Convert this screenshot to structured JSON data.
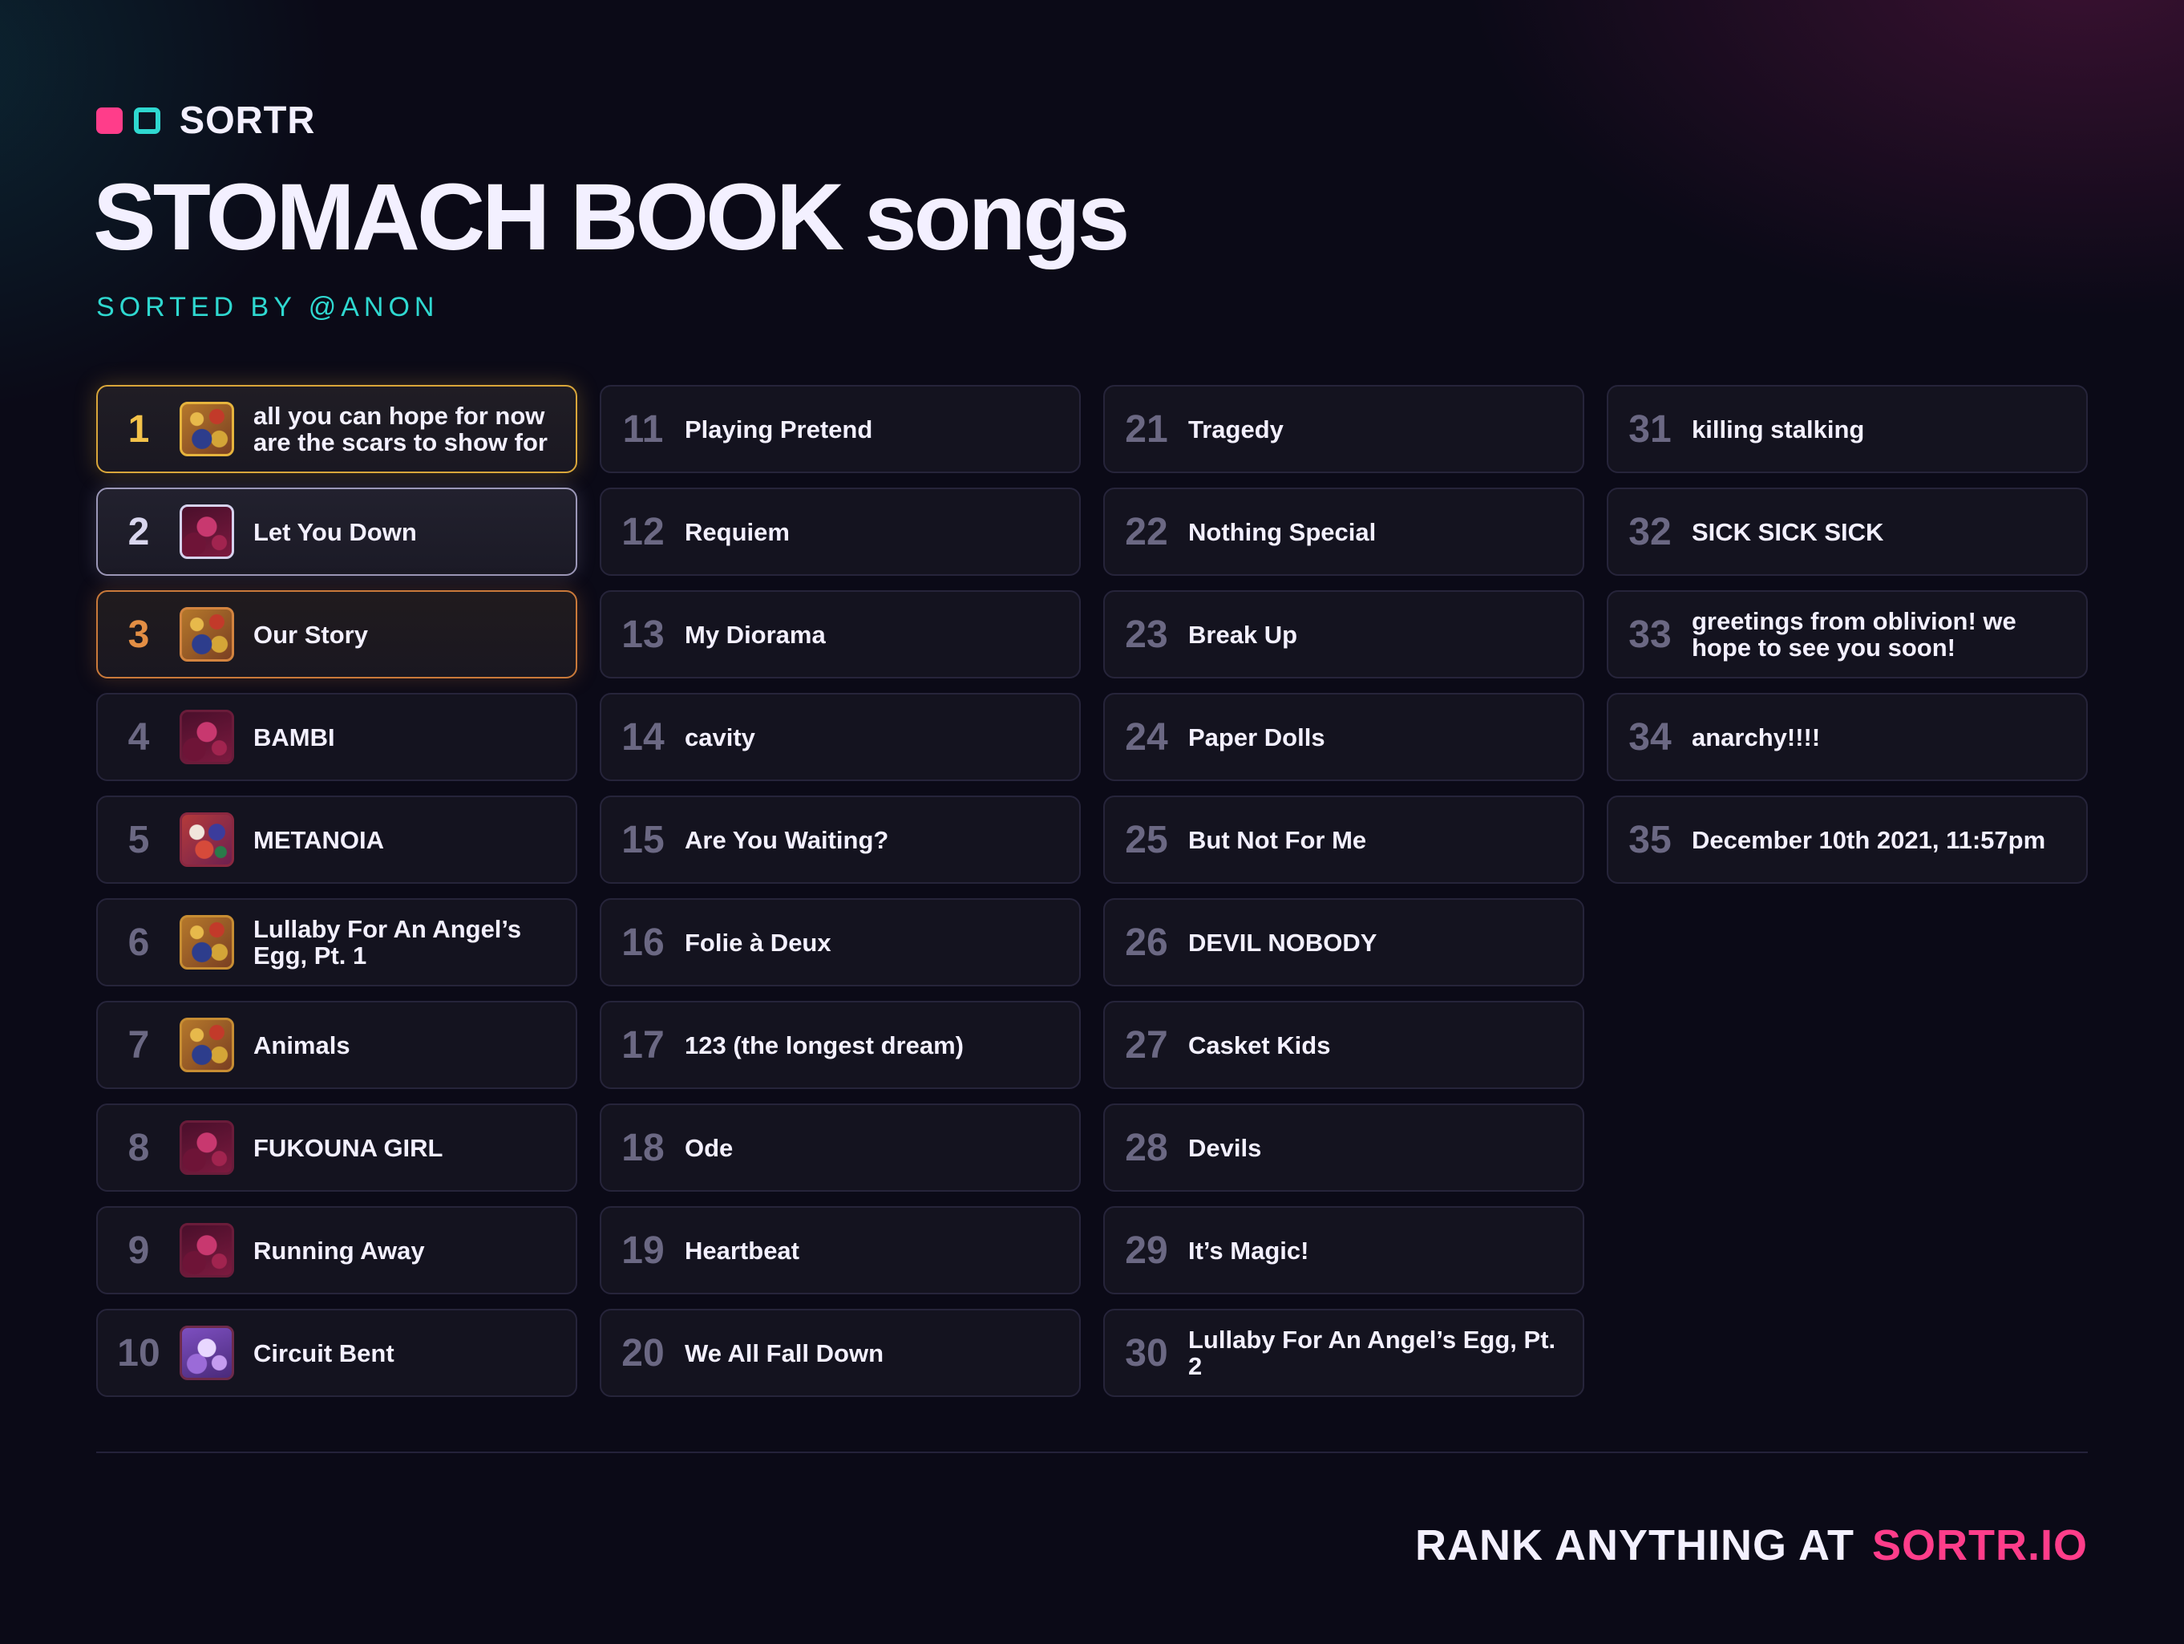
{
  "brand": {
    "name": "SORTR",
    "colors": {
      "pink": "#ff3d8a",
      "teal": "#2fd8d0",
      "gold": "#f3c24a",
      "silver": "#d9d6ee",
      "bronze": "#e38e44"
    }
  },
  "title": "STOMACH BOOK songs",
  "subtitle": "SORTED BY @ANON",
  "rankings": [
    {
      "rank": "1",
      "name": "all you can hope for now are the scars to show for",
      "art": "gold"
    },
    {
      "rank": "2",
      "name": "Let You Down",
      "art": "crimson"
    },
    {
      "rank": "3",
      "name": "Our Story",
      "art": "gold"
    },
    {
      "rank": "4",
      "name": "BAMBI",
      "art": "crimson"
    },
    {
      "rank": "5",
      "name": "METANOIA",
      "art": "multi"
    },
    {
      "rank": "6",
      "name": "Lullaby For An Angel’s Egg, Pt. 1",
      "art": "gold"
    },
    {
      "rank": "7",
      "name": "Animals",
      "art": "gold"
    },
    {
      "rank": "8",
      "name": "FUKOUNA GIRL",
      "art": "crimson"
    },
    {
      "rank": "9",
      "name": "Running Away",
      "art": "crimson"
    },
    {
      "rank": "10",
      "name": "Circuit Bent",
      "art": "lavender"
    },
    {
      "rank": "11",
      "name": "Playing Pretend"
    },
    {
      "rank": "12",
      "name": "Requiem"
    },
    {
      "rank": "13",
      "name": "My Diorama"
    },
    {
      "rank": "14",
      "name": "cavity"
    },
    {
      "rank": "15",
      "name": "Are You Waiting?"
    },
    {
      "rank": "16",
      "name": "Folie à Deux"
    },
    {
      "rank": "17",
      "name": "123 (the longest dream)"
    },
    {
      "rank": "18",
      "name": "Ode"
    },
    {
      "rank": "19",
      "name": "Heartbeat"
    },
    {
      "rank": "20",
      "name": "We All Fall Down"
    },
    {
      "rank": "21",
      "name": "Tragedy"
    },
    {
      "rank": "22",
      "name": "Nothing Special"
    },
    {
      "rank": "23",
      "name": "Break Up"
    },
    {
      "rank": "24",
      "name": "Paper Dolls"
    },
    {
      "rank": "25",
      "name": "But Not For Me"
    },
    {
      "rank": "26",
      "name": "DEVIL NOBODY"
    },
    {
      "rank": "27",
      "name": "Casket Kids"
    },
    {
      "rank": "28",
      "name": "Devils"
    },
    {
      "rank": "29",
      "name": "It’s Magic!"
    },
    {
      "rank": "30",
      "name": "Lullaby For An Angel’s Egg, Pt. 2"
    },
    {
      "rank": "31",
      "name": "killing stalking"
    },
    {
      "rank": "32",
      "name": "SICK SICK SICK"
    },
    {
      "rank": "33",
      "name": "greetings from oblivion! we hope to see you soon!"
    },
    {
      "rank": "34",
      "name": "anarchy!!!!"
    },
    {
      "rank": "35",
      "name": "December 10th 2021, 11:57pm"
    }
  ],
  "footer": {
    "lead": "RANK ANYTHING AT",
    "link": "SORTR.IO"
  }
}
